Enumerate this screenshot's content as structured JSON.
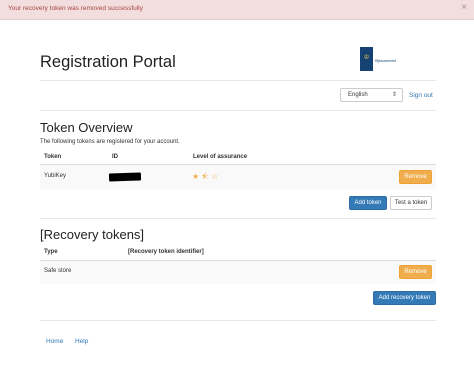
{
  "alert": {
    "message": "Your recovery token was removed successfully",
    "close_glyph": "×"
  },
  "header": {
    "title": "Registration Portal",
    "logo_text": "Rijksoverheid",
    "brand_color": "#154273"
  },
  "toolbar": {
    "language": "English",
    "language_options": [
      "English"
    ],
    "sign_out_label": "Sign out"
  },
  "tokens": {
    "heading": "Token Overview",
    "subtitle": "The following tokens are registered for your account.",
    "columns": [
      "Token",
      "ID",
      "Level of assurance"
    ],
    "rows": [
      {
        "token": "YubiKey",
        "id": "[redacted]",
        "level_of_assurance": 1.5,
        "level_max": 3,
        "action": "Remove"
      }
    ],
    "add_button": "Add token",
    "test_button": "Test a token"
  },
  "recovery": {
    "heading": "[Recovery tokens]",
    "columns": [
      "Type",
      "[Recovery token identifier]"
    ],
    "rows": [
      {
        "type": "Safe store",
        "identifier": "",
        "action": "Remove"
      }
    ],
    "add_button": "Add recovery token"
  },
  "footer": {
    "links": [
      "Home",
      "Help"
    ]
  },
  "colors": {
    "primary": "#337ab7",
    "warning": "#f0ad4e",
    "alert_bg": "#f2dede",
    "alert_text": "#a94442"
  }
}
